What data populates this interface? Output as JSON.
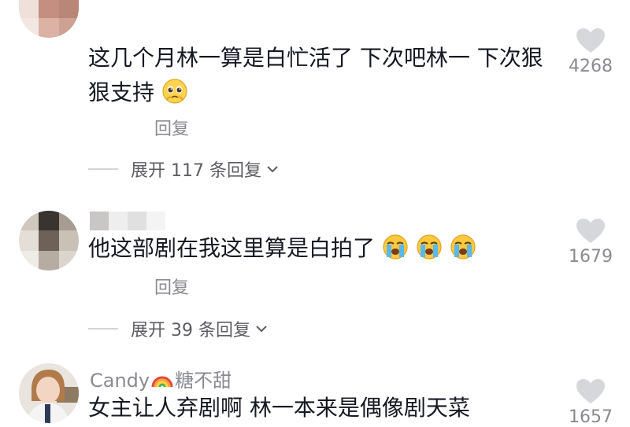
{
  "comments": [
    {
      "username": "",
      "text": "这几个月林一算是白忙活了 下次吧林一 下次狠狠支持",
      "emojis": [
        "pleading-face"
      ],
      "reply_label": "回复",
      "expand_label": "展开 117 条回复",
      "likes": "4268"
    },
    {
      "username": "",
      "text": "他这部剧在我这里算是白拍了",
      "emojis": [
        "loudly-crying-face",
        "loudly-crying-face",
        "loudly-crying-face"
      ],
      "reply_label": "回复",
      "expand_label": "展开 39 条回复",
      "likes": "1679"
    },
    {
      "username_prefix": "Candy",
      "username_suffix": "糖不甜",
      "username_icon": "rainbow-emoji",
      "text": "女主让人弃剧啊  林一本来是偶像剧天菜",
      "likes": "1657"
    }
  ],
  "colors": {
    "primary_text": "#161823",
    "secondary_text": "#8a8b91",
    "heart": "#d6d7da"
  }
}
